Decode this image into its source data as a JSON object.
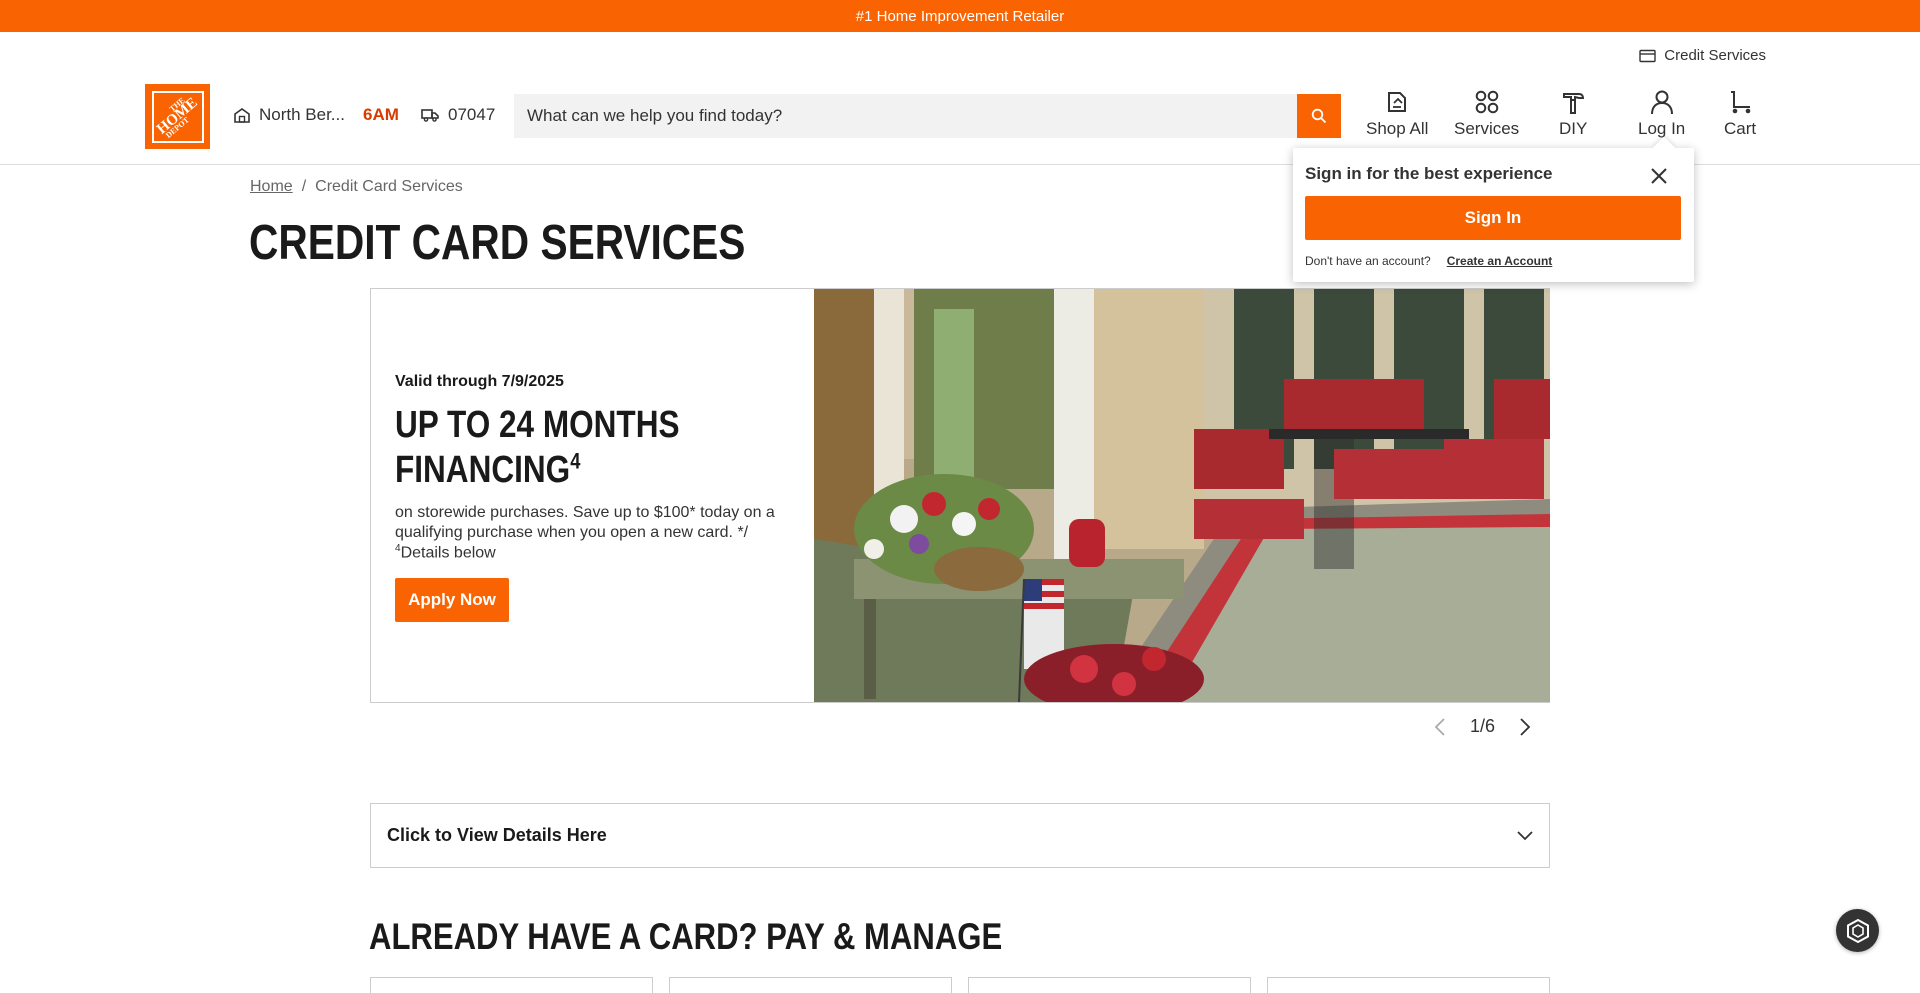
{
  "promo": {
    "text": "#1 Home Improvement Retailer"
  },
  "utility": {
    "credit_services": "Credit Services"
  },
  "header": {
    "store_name": "North Ber...",
    "store_hours": "6AM",
    "zip": "07047",
    "search_placeholder": "What can we help you find today?",
    "nav": [
      {
        "label": "Shop All",
        "icon": "shop-all-icon"
      },
      {
        "label": "Services",
        "icon": "services-icon"
      },
      {
        "label": "DIY",
        "icon": "diy-hammer-icon"
      },
      {
        "label": "Log In",
        "icon": "user-icon"
      },
      {
        "label": "Cart",
        "icon": "cart-icon"
      }
    ]
  },
  "signin_popover": {
    "title": "Sign in for the best experience",
    "button": "Sign In",
    "no_account": "Don't have an account?",
    "create_account": "Create an Account"
  },
  "breadcrumb": {
    "home": "Home",
    "separator": "/",
    "current": "Credit Card Services"
  },
  "page_title": "CREDIT CARD SERVICES",
  "hero": {
    "valid": "Valid through 7/9/2025",
    "headline": "UP TO 24 MONTHS FINANCING",
    "headline_sup": "4",
    "copy_line1": "on storewide purchases. Save up to $100* today on a qualifying purchase when you open a new card. */",
    "copy_sup": "4",
    "copy_line2": "Details below",
    "cta": "Apply Now"
  },
  "carousel": {
    "indicator": "1/6"
  },
  "details": {
    "label": "Click to View Details Here"
  },
  "section_title": "ALREADY HAVE A CARD? PAY & MANAGE",
  "colors": {
    "brand_orange": "#f96302",
    "text_dark": "#1a1a1a"
  }
}
